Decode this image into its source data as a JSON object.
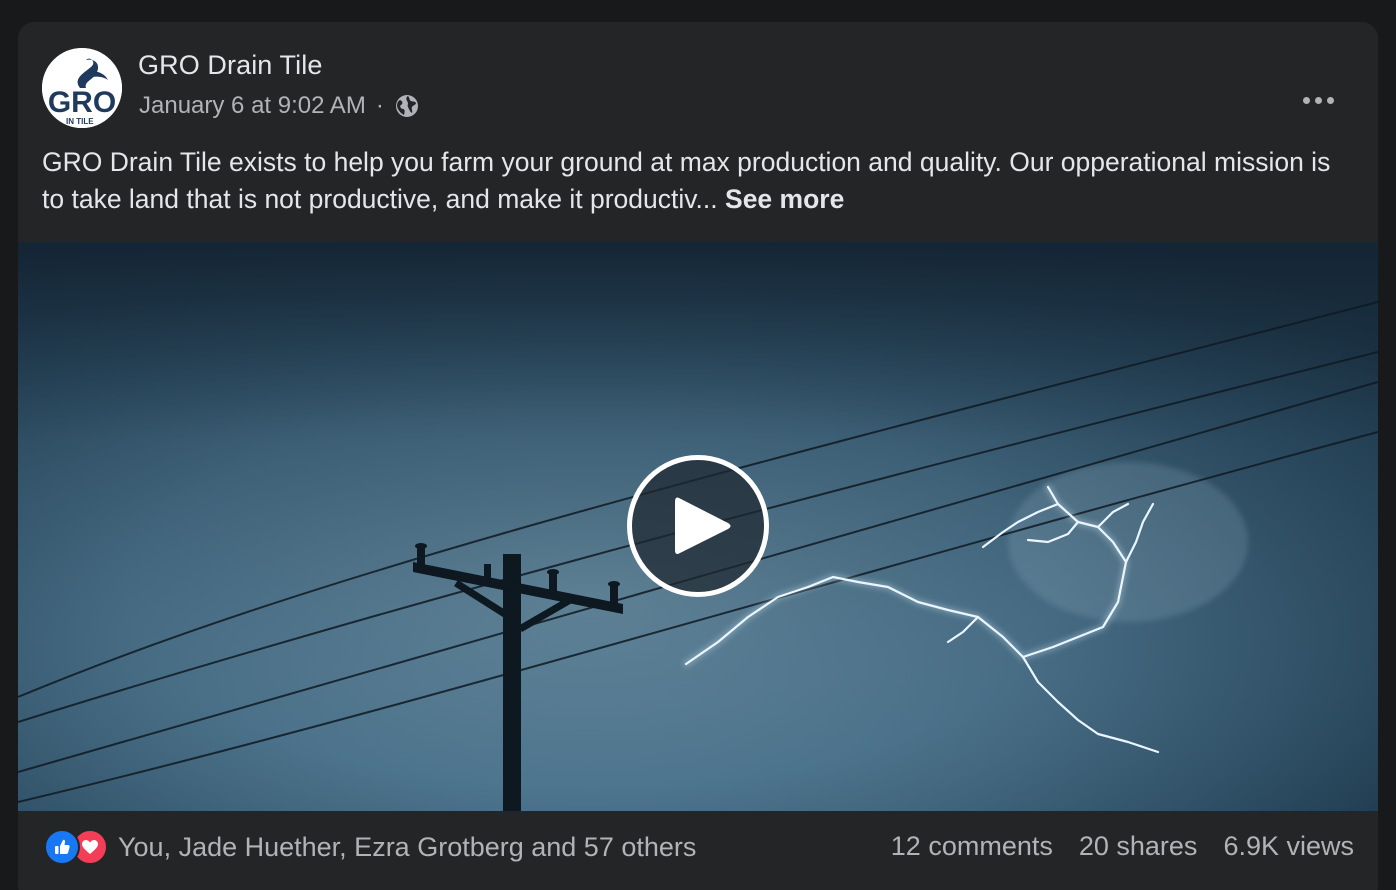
{
  "post": {
    "page_name": "GRO Drain Tile",
    "timestamp": "January 6 at 9:02 AM",
    "separator": "·",
    "audience_icon": "globe-icon",
    "text": "GRO Drain Tile exists to help you farm your ground at max production and quality. Our opperational mission is to take land that is not productive, and make it productiv...",
    "see_more_label": "See more",
    "avatar": {
      "logo_text": "GRO",
      "logo_subtext": "IN TILE"
    }
  },
  "video": {
    "play_icon": "play-icon"
  },
  "engagement": {
    "reaction_icons": [
      "like-icon",
      "love-icon"
    ],
    "reaction_names": "You, Jade Huether, Ezra Grotberg and 57 others",
    "comments": "12 comments",
    "shares": "20 shares",
    "views": "6.9K views"
  },
  "colors": {
    "background": "#18191a",
    "card": "#242526",
    "primary_text": "#e4e6eb",
    "secondary_text": "#b0b3b8",
    "like_blue": "#1877f2",
    "love_red": "#f33e58"
  }
}
